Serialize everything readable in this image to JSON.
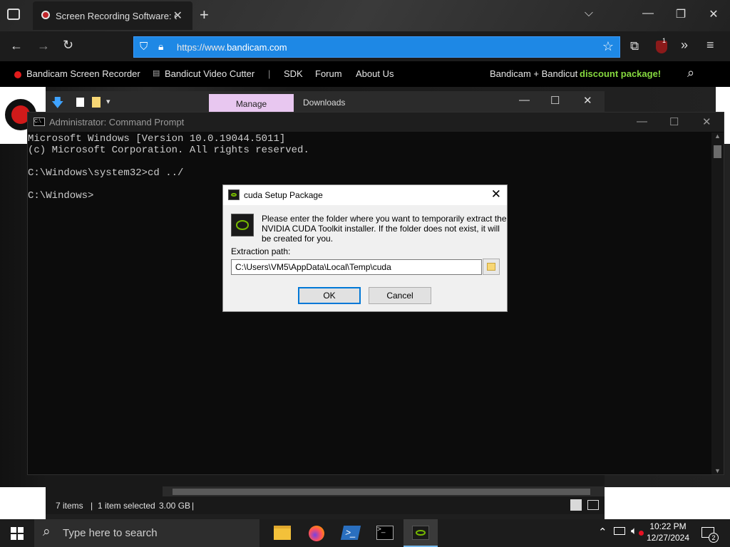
{
  "browser": {
    "tab_title": "Screen Recording Software: cap",
    "url_prefix": "https://www.",
    "url_domain": "bandicam.com",
    "new_tab": "+",
    "close": "✕",
    "notify_badge": "1"
  },
  "site_nav": {
    "brand": "Bandicam Screen Recorder",
    "bandicut": "Bandicut Video Cutter",
    "sep": "|",
    "sdk": "SDK",
    "forum": "Forum",
    "about": "About Us",
    "promo_prefix": "Bandicam + Bandicut",
    "promo_highlight": "discount package!"
  },
  "explorer": {
    "manage_tab": "Manage",
    "downloads_tab": "Downloads",
    "status_items": "7 items",
    "status_sep": "|",
    "status_selected": "1 item selected",
    "status_size": "3.00 GB"
  },
  "cmd": {
    "title": "Administrator: Command Prompt",
    "icon_text": "C:\\.",
    "lines": "Microsoft Windows [Version 10.0.19044.5011]\n(c) Microsoft Corporation. All rights reserved.\n\nC:\\Windows\\system32>cd ../\n\nC:\\Windows>"
  },
  "dialog": {
    "title": "cuda Setup Package",
    "message": "Please enter the folder where you want to temporarily extract the NVIDIA CUDA Toolkit installer. If the folder does not exist, it will be created for you.",
    "label": "Extraction path:",
    "path": "C:\\Users\\VM5\\AppData\\Local\\Temp\\cuda",
    "ok": "OK",
    "cancel": "Cancel"
  },
  "taskbar": {
    "search_placeholder": "Type here to search",
    "time": "10:22 PM",
    "date": "12/27/2024",
    "notification_count": "2",
    "apps": [
      "file-explorer",
      "firefox",
      "powershell",
      "terminal",
      "nvidia-installer"
    ]
  },
  "colors": {
    "url_bar": "#1e88e5",
    "manage_tab": "#e8c7f0",
    "promo_green": "#86d93f",
    "nvidia_green": "#76b900",
    "ok_border": "#0078d7"
  }
}
